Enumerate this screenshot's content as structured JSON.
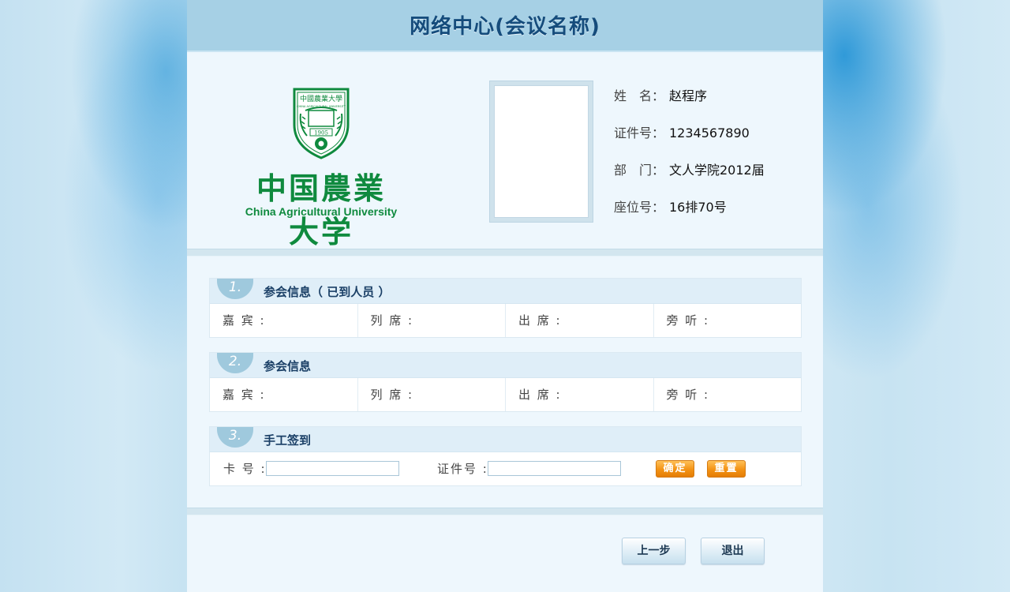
{
  "header": {
    "title": "网络中心(会议名称)"
  },
  "logo": {
    "cn_name": "中国農業大学",
    "en_name": "China Agricultural University",
    "emblem_text": "中國農業大學",
    "emblem_subtitle": "CHINA AGRICULTURAL UNIVERSITY",
    "emblem_year": "1905"
  },
  "attendee": {
    "fields": [
      {
        "label": "姓　名：",
        "value": "赵程序"
      },
      {
        "label": "证件号：",
        "value": "1234567890"
      },
      {
        "label": "部　门：",
        "value": "文人学院2012届"
      },
      {
        "label": "座位号：",
        "value": "16排70号"
      }
    ]
  },
  "sections": [
    {
      "number": "1.",
      "title": "参会信息（ 已到人员 ）",
      "cells": [
        "嘉 宾 :",
        "列 席 :",
        "出 席 :",
        "旁 听 :"
      ]
    },
    {
      "number": "2.",
      "title": "参会信息",
      "cells": [
        "嘉 宾 :",
        "列 席 :",
        "出 席 :",
        "旁 听 :"
      ]
    },
    {
      "number": "3.",
      "title": "手工签到"
    }
  ],
  "signin": {
    "card_label": "卡 号 :",
    "card_value": "",
    "id_label": "证件号 :",
    "id_value": "",
    "confirm_label": "确定",
    "reset_label": "重置"
  },
  "footer": {
    "prev_label": "上一步",
    "exit_label": "退出"
  },
  "colors": {
    "accent_blue": "#154c7c",
    "emblem_green": "#0f8a3e",
    "button_orange": "#f39214"
  }
}
